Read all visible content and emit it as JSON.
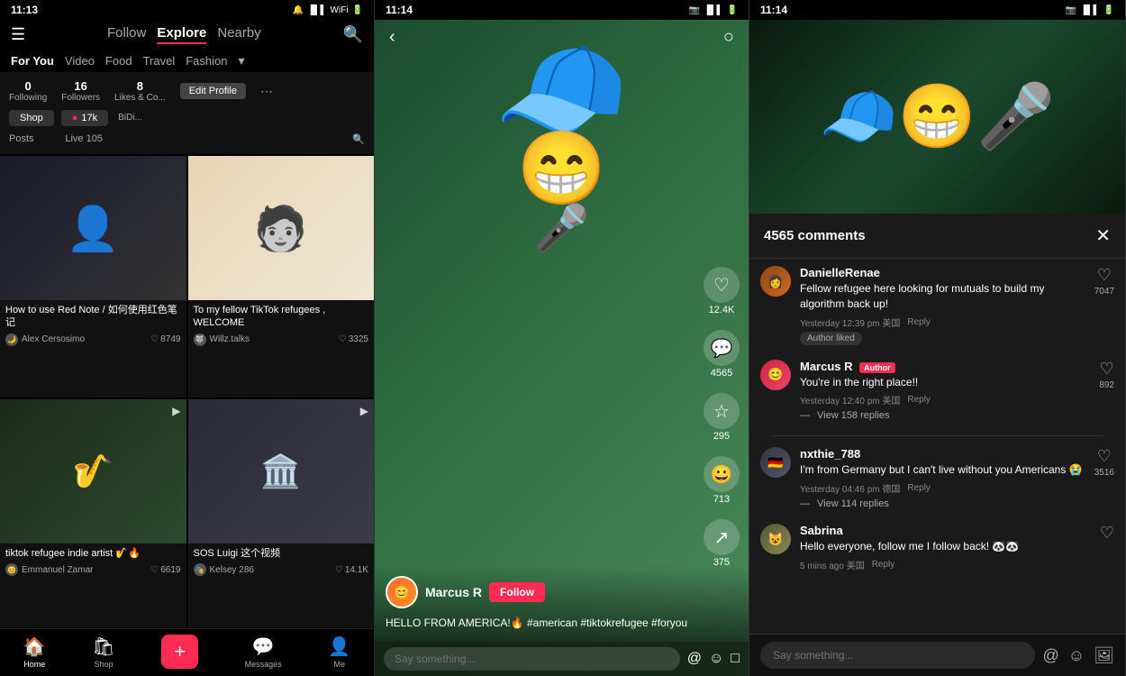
{
  "phone1": {
    "status_time": "11:13",
    "nav": {
      "follow": "Follow",
      "explore": "Explore",
      "nearby": "Nearby"
    },
    "categories": [
      "For You",
      "Video",
      "Food",
      "Travel",
      "Fashion"
    ],
    "profile": {
      "following": "0",
      "followers": "16",
      "likes": "8",
      "following_label": "Following",
      "followers_label": "Followers",
      "likes_label": "Likes & Co...",
      "edit_btn": "Edit Profile"
    },
    "videos": [
      {
        "title": "How to use Red Note / 如何使用红色笔记",
        "author": "Alex Cersosimo",
        "likes": "8749",
        "bg": "person1"
      },
      {
        "title": "To my fellow TikTok refugees , WELCOME",
        "author": "Willz.talks",
        "likes": "3325",
        "bg": "person2"
      },
      {
        "title": "tiktok refugee indie artist 🎷🔥",
        "author": "Emmanuel Zamar",
        "likes": "6619",
        "bg": "person3"
      },
      {
        "title": "SOS Luigi 这个视频",
        "author": "Kelsey 286",
        "likes": "14.1K",
        "bg": "person4"
      }
    ],
    "bottom_nav": [
      "Home",
      "Shop",
      "",
      "Messages",
      "Me"
    ]
  },
  "phone2": {
    "status_time": "11:14",
    "author": "Marcus R",
    "follow_label": "Follow",
    "caption": "HELLO FROM AMERICA!🔥 #american #tiktokrefugee #foryou",
    "actions": {
      "likes": "12.4K",
      "comments": "4565",
      "favorites": "295",
      "share_count": "713",
      "forwards": "375"
    },
    "comment_placeholder": "Say something..."
  },
  "phone3": {
    "status_time": "11:14",
    "comments_title": "4565 comments",
    "comments": [
      {
        "username": "DanielleRenae",
        "is_author": false,
        "text": "Fellow refugee here looking for mutuals to build my algorithm back up!",
        "time": "Yesterday 12:39 pm 美国",
        "reply": "Reply",
        "likes": "7047",
        "author_liked": true
      },
      {
        "username": "Marcus R",
        "is_author": true,
        "text": "You're in the right place!!",
        "time": "Yesterday 12:40 pm 美国",
        "reply": "Reply",
        "likes": "892",
        "view_replies": "View 158 replies"
      },
      {
        "username": "nxthie_788",
        "is_author": false,
        "text": "I'm from Germany but I can't live without you Americans 😭",
        "time": "Yesterday 04:46 pm 德国",
        "reply": "Reply",
        "likes": "3516",
        "view_replies": "View 114 replies"
      },
      {
        "username": "Sabrina",
        "is_author": false,
        "text": "Hello everyone, follow me I follow back! 🐼🐼",
        "time": "5 mins ago 美国",
        "reply": "Reply",
        "likes": "",
        "view_replies": ""
      }
    ],
    "comment_placeholder": "Say something..."
  }
}
